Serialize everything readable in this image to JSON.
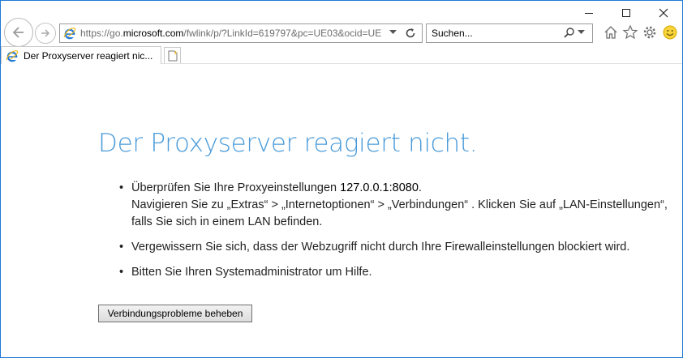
{
  "address_bar": {
    "url_prefix": "https://go.",
    "url_host": "microsoft.com",
    "url_rest": "/fwlink/p/?LinkId=619797&pc=UE03&ocid=UE"
  },
  "search": {
    "placeholder": "Suchen..."
  },
  "tab": {
    "title": "Der Proxyserver reagiert nic..."
  },
  "page": {
    "title": "Der Proxyserver reagiert nicht.",
    "bullet1_text": "Überprüfen Sie Ihre Proxyeinstellungen ",
    "bullet1_address": "127.0.0.1:8080",
    "bullet1_end": ".",
    "bullet1_line2": "Navigieren Sie zu „Extras“ > „Internetoptionen“ > „Verbindungen“ . Klicken Sie auf „LAN-Einstellungen“, falls Sie sich in einem LAN befinden.",
    "bullet2": "Vergewissern Sie sich, dass der Webzugriff nicht durch Ihre Firewalleinstellungen blockiert wird.",
    "bullet3": "Bitten Sie Ihren Systemadministrator um Hilfe.",
    "fix_button": "Verbindungsprobleme beheben"
  },
  "colors": {
    "title_blue": "#4a9bd9",
    "ie_blue": "#1e78d7",
    "window_border": "#1e78d7"
  },
  "icons": [
    "back-arrow-icon",
    "forward-arrow-icon",
    "ie-logo-icon",
    "dropdown-arrow-icon",
    "refresh-icon",
    "search-icon",
    "home-icon",
    "favorites-star-icon",
    "settings-gear-icon",
    "feedback-smiley-icon",
    "new-tab-icon"
  ]
}
